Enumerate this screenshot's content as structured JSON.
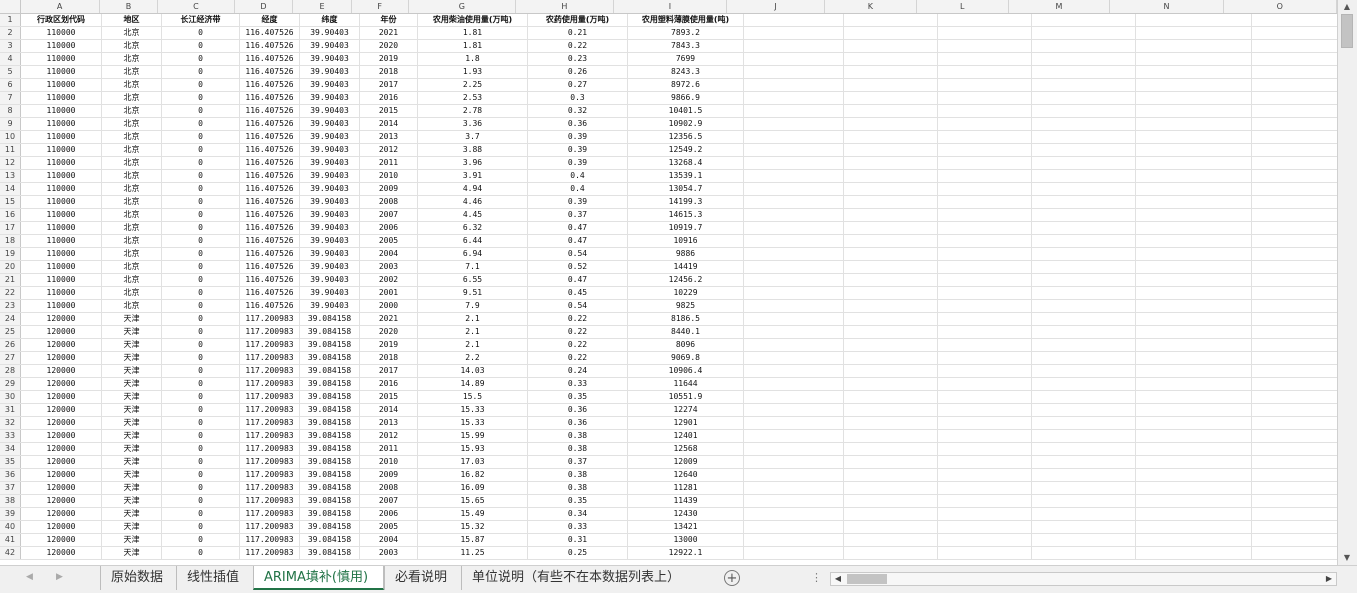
{
  "columns": [
    "A",
    "B",
    "C",
    "D",
    "E",
    "F",
    "G",
    "H",
    "I",
    "J",
    "K",
    "L",
    "M",
    "N",
    "O"
  ],
  "header": [
    "行政区划代码",
    "地区",
    "长江经济带",
    "经度",
    "纬度",
    "年份",
    "农用柴油使用量(万吨)",
    "农药使用量(万吨)",
    "农用塑料薄膜使用量(吨)"
  ],
  "rows": [
    [
      "110000",
      "北京",
      "0",
      "116.407526",
      "39.90403",
      "2021",
      "1.81",
      "0.21",
      "7893.2"
    ],
    [
      "110000",
      "北京",
      "0",
      "116.407526",
      "39.90403",
      "2020",
      "1.81",
      "0.22",
      "7843.3"
    ],
    [
      "110000",
      "北京",
      "0",
      "116.407526",
      "39.90403",
      "2019",
      "1.8",
      "0.23",
      "7699"
    ],
    [
      "110000",
      "北京",
      "0",
      "116.407526",
      "39.90403",
      "2018",
      "1.93",
      "0.26",
      "8243.3"
    ],
    [
      "110000",
      "北京",
      "0",
      "116.407526",
      "39.90403",
      "2017",
      "2.25",
      "0.27",
      "8972.6"
    ],
    [
      "110000",
      "北京",
      "0",
      "116.407526",
      "39.90403",
      "2016",
      "2.53",
      "0.3",
      "9866.9"
    ],
    [
      "110000",
      "北京",
      "0",
      "116.407526",
      "39.90403",
      "2015",
      "2.78",
      "0.32",
      "10401.5"
    ],
    [
      "110000",
      "北京",
      "0",
      "116.407526",
      "39.90403",
      "2014",
      "3.36",
      "0.36",
      "10902.9"
    ],
    [
      "110000",
      "北京",
      "0",
      "116.407526",
      "39.90403",
      "2013",
      "3.7",
      "0.39",
      "12356.5"
    ],
    [
      "110000",
      "北京",
      "0",
      "116.407526",
      "39.90403",
      "2012",
      "3.88",
      "0.39",
      "12549.2"
    ],
    [
      "110000",
      "北京",
      "0",
      "116.407526",
      "39.90403",
      "2011",
      "3.96",
      "0.39",
      "13268.4"
    ],
    [
      "110000",
      "北京",
      "0",
      "116.407526",
      "39.90403",
      "2010",
      "3.91",
      "0.4",
      "13539.1"
    ],
    [
      "110000",
      "北京",
      "0",
      "116.407526",
      "39.90403",
      "2009",
      "4.94",
      "0.4",
      "13054.7"
    ],
    [
      "110000",
      "北京",
      "0",
      "116.407526",
      "39.90403",
      "2008",
      "4.46",
      "0.39",
      "14199.3"
    ],
    [
      "110000",
      "北京",
      "0",
      "116.407526",
      "39.90403",
      "2007",
      "4.45",
      "0.37",
      "14615.3"
    ],
    [
      "110000",
      "北京",
      "0",
      "116.407526",
      "39.90403",
      "2006",
      "6.32",
      "0.47",
      "10919.7"
    ],
    [
      "110000",
      "北京",
      "0",
      "116.407526",
      "39.90403",
      "2005",
      "6.44",
      "0.47",
      "10916"
    ],
    [
      "110000",
      "北京",
      "0",
      "116.407526",
      "39.90403",
      "2004",
      "6.94",
      "0.54",
      "9886"
    ],
    [
      "110000",
      "北京",
      "0",
      "116.407526",
      "39.90403",
      "2003",
      "7.1",
      "0.52",
      "14419"
    ],
    [
      "110000",
      "北京",
      "0",
      "116.407526",
      "39.90403",
      "2002",
      "6.55",
      "0.47",
      "12456.2"
    ],
    [
      "110000",
      "北京",
      "0",
      "116.407526",
      "39.90403",
      "2001",
      "9.51",
      "0.45",
      "10229"
    ],
    [
      "110000",
      "北京",
      "0",
      "116.407526",
      "39.90403",
      "2000",
      "7.9",
      "0.54",
      "9825"
    ],
    [
      "120000",
      "天津",
      "0",
      "117.200983",
      "39.084158",
      "2021",
      "2.1",
      "0.22",
      "8186.5"
    ],
    [
      "120000",
      "天津",
      "0",
      "117.200983",
      "39.084158",
      "2020",
      "2.1",
      "0.22",
      "8440.1"
    ],
    [
      "120000",
      "天津",
      "0",
      "117.200983",
      "39.084158",
      "2019",
      "2.1",
      "0.22",
      "8096"
    ],
    [
      "120000",
      "天津",
      "0",
      "117.200983",
      "39.084158",
      "2018",
      "2.2",
      "0.22",
      "9069.8"
    ],
    [
      "120000",
      "天津",
      "0",
      "117.200983",
      "39.084158",
      "2017",
      "14.03",
      "0.24",
      "10906.4"
    ],
    [
      "120000",
      "天津",
      "0",
      "117.200983",
      "39.084158",
      "2016",
      "14.89",
      "0.33",
      "11644"
    ],
    [
      "120000",
      "天津",
      "0",
      "117.200983",
      "39.084158",
      "2015",
      "15.5",
      "0.35",
      "10551.9"
    ],
    [
      "120000",
      "天津",
      "0",
      "117.200983",
      "39.084158",
      "2014",
      "15.33",
      "0.36",
      "12274"
    ],
    [
      "120000",
      "天津",
      "0",
      "117.200983",
      "39.084158",
      "2013",
      "15.33",
      "0.36",
      "12901"
    ],
    [
      "120000",
      "天津",
      "0",
      "117.200983",
      "39.084158",
      "2012",
      "15.99",
      "0.38",
      "12401"
    ],
    [
      "120000",
      "天津",
      "0",
      "117.200983",
      "39.084158",
      "2011",
      "15.93",
      "0.38",
      "12568"
    ],
    [
      "120000",
      "天津",
      "0",
      "117.200983",
      "39.084158",
      "2010",
      "17.03",
      "0.37",
      "12009"
    ],
    [
      "120000",
      "天津",
      "0",
      "117.200983",
      "39.084158",
      "2009",
      "16.82",
      "0.38",
      "12640"
    ],
    [
      "120000",
      "天津",
      "0",
      "117.200983",
      "39.084158",
      "2008",
      "16.09",
      "0.38",
      "11281"
    ],
    [
      "120000",
      "天津",
      "0",
      "117.200983",
      "39.084158",
      "2007",
      "15.65",
      "0.35",
      "11439"
    ],
    [
      "120000",
      "天津",
      "0",
      "117.200983",
      "39.084158",
      "2006",
      "15.49",
      "0.34",
      "12430"
    ],
    [
      "120000",
      "天津",
      "0",
      "117.200983",
      "39.084158",
      "2005",
      "15.32",
      "0.33",
      "13421"
    ],
    [
      "120000",
      "天津",
      "0",
      "117.200983",
      "39.084158",
      "2004",
      "15.87",
      "0.31",
      "13000"
    ],
    [
      "120000",
      "天津",
      "0",
      "117.200983",
      "39.084158",
      "2003",
      "11.25",
      "0.25",
      "12922.1"
    ]
  ],
  "tabs": [
    "原始数据",
    "线性插值",
    "ARIMA填补(慎用)",
    "必看说明",
    "单位说明（有些不在本数据列表上）"
  ],
  "active_tab": "ARIMA填补(慎用)",
  "colors": {
    "accent": "#217346",
    "grid": "#e1e1e1",
    "header_bg": "#f3f3f3"
  }
}
